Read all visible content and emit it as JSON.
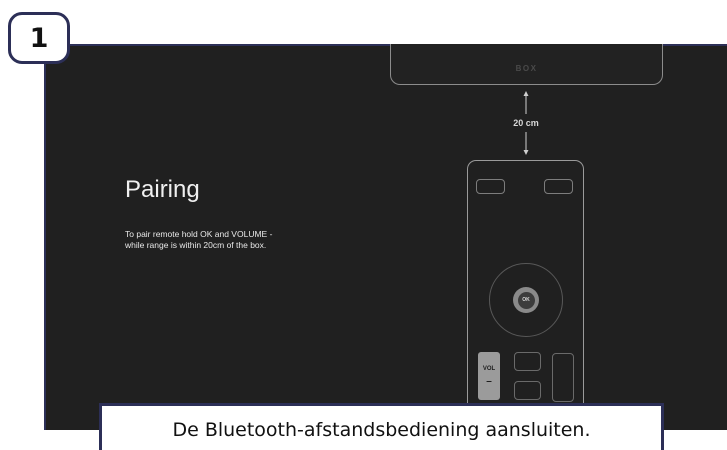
{
  "step": {
    "number": "1"
  },
  "screen": {
    "title": "Pairing",
    "description": "To pair remote hold OK and VOLUME -\nwhile range is within 20cm of the box."
  },
  "illustration": {
    "box_label": "BOX",
    "distance_label": "20 cm",
    "ok_label": "OK",
    "vol_label": "VOL",
    "vol_minus": "–"
  },
  "caption": {
    "text": "De Bluetooth-afstandsbediening aansluiten."
  },
  "colors": {
    "frame_border": "#2c2f57",
    "screen_background": "#202020",
    "page_background": "#ffffff"
  }
}
